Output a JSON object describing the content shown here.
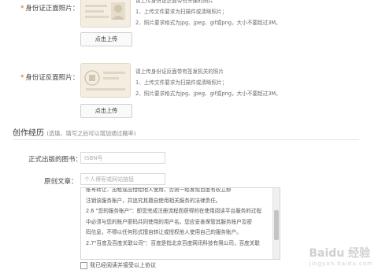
{
  "front": {
    "label": "身份证正面照片：",
    "hint_title": "请上传身份证正面带有头像的照片",
    "hint_1": "1、上传文件要求为扫描件或清晰照片；",
    "hint_2": "2、照片要求格式为jpg、jpeg、gif或png，大小不要超过3M。",
    "upload_label": "点击上传"
  },
  "back": {
    "label": "身份证反面照片：",
    "hint_title": "请上传身份证反面带有签发机关的照片",
    "hint_1": "1、上传文件要求为扫描件或清晰照片；",
    "hint_2": "2、照片要求格式为jpg、jpeg、gif或png，大小不要超过3M。",
    "upload_label": "点击上传"
  },
  "section": {
    "title": "创作经历",
    "subtitle": "(选填，填写之后可以增加通过概率)"
  },
  "form": {
    "book_label": "正式出版的图书：",
    "book_placeholder": "ISBN号",
    "original_label": "原创文章：",
    "original_placeholder": "个人博客或网站链接"
  },
  "agreement": {
    "lines": [
      "账号转让、出租或出借给他人使用，否则一经发现百度有权立即",
      "注销该服务账户，并追究其擅自使用相关服务的法律责任。",
      "2.6 \"您的服务账户\"：即您完成注册流程而获得的在使用阅读平台服务的过程",
      "中必须与您的账户密码共同使用的用户名。您应妥善保管其服务账户及密",
      "码信息，不得以任何形式擅自转让或授权他人使用自己的服务账户。",
      "2.7\"百度及百度关联公司\"：百度是指北京百度网讯科技有限公司，百度关联"
    ],
    "checkbox_label": "我已经阅读并接受以上协议"
  },
  "watermark": {
    "text": "Baidu 经验",
    "sub": "jingyan.baidu.com"
  }
}
